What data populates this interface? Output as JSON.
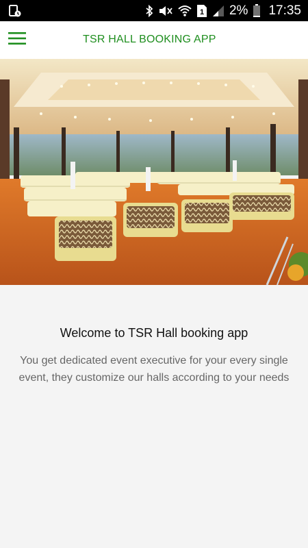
{
  "status_bar": {
    "battery_percent": "2%",
    "time": "17:35",
    "sim_slot": "1",
    "icons": [
      "screen-record-icon",
      "bluetooth-icon",
      "mute-icon",
      "wifi-icon",
      "sim-1-icon",
      "signal-icon",
      "battery-icon"
    ]
  },
  "app_bar": {
    "title": "TSR HALL BOOKING APP",
    "menu_icon": "hamburger-menu-icon",
    "accent_color": "#1e8e1e"
  },
  "hero": {
    "image": "banquet-hall-photo"
  },
  "main": {
    "heading": "Welcome to TSR Hall booking app",
    "description": "You get dedicated event executive for your every single event, they customize our halls according to your needs"
  }
}
